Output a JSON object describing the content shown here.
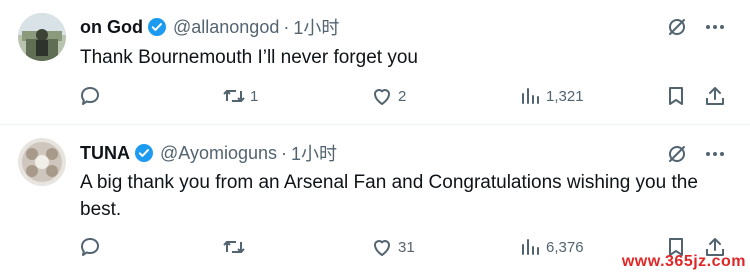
{
  "tweets": [
    {
      "name": "on God",
      "handle": "@allanongod",
      "separator": "·",
      "time": "1小时",
      "text": "Thank Bournemouth I’ll never forget you",
      "replies": "",
      "retweets": "1",
      "likes": "2",
      "views": "1,321"
    },
    {
      "name": "TUNA",
      "handle": "@Ayomioguns",
      "separator": "·",
      "time": "1小时",
      "text": "A big thank you from an Arsenal Fan and Congratulations wishing you the best.",
      "replies": "",
      "retweets": "",
      "likes": "31",
      "views": "6,376"
    }
  ],
  "watermark": "www.365jz.com",
  "colors": {
    "verified": "#1d9bf0",
    "secondary_text": "#536471",
    "watermark": "#e02727"
  },
  "icons": [
    "verified-badge-icon",
    "grok-icon",
    "more-icon",
    "reply-icon",
    "retweet-icon",
    "like-icon",
    "views-icon",
    "bookmark-icon",
    "share-icon"
  ]
}
